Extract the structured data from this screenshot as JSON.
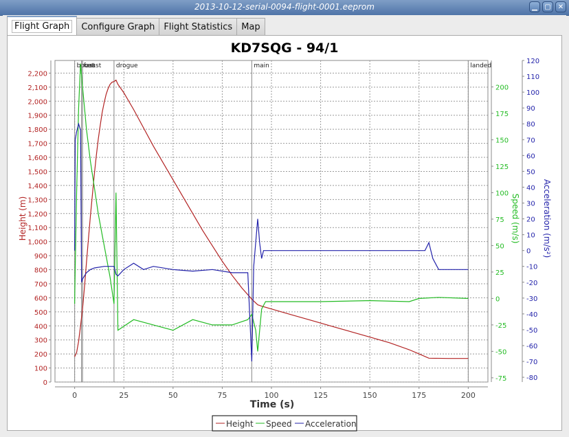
{
  "window": {
    "title": "2013-10-12-serial-0094-flight-0001.eeprom",
    "buttons": [
      "minimize",
      "maximize",
      "close"
    ]
  },
  "tabs": [
    {
      "label": "Flight Graph",
      "active": true
    },
    {
      "label": "Configure Graph",
      "active": false
    },
    {
      "label": "Flight Statistics",
      "active": false
    },
    {
      "label": "Map",
      "active": false
    }
  ],
  "chart_data": {
    "type": "line",
    "title": "KD7SQG - 94/1",
    "xlabel": "Time (s)",
    "xlim": [
      -10,
      210
    ],
    "xticks": [
      0,
      25,
      50,
      75,
      100,
      125,
      150,
      175,
      200
    ],
    "grid": true,
    "legend_position": "bottom-center",
    "axes": {
      "height": {
        "label": "Height (m)",
        "side": "left",
        "color": "#b22222",
        "ylim": [
          0,
          2290
        ],
        "ticks": [
          0,
          100,
          200,
          300,
          400,
          500,
          600,
          700,
          800,
          900,
          1000,
          1100,
          1200,
          1300,
          1400,
          1500,
          1600,
          1700,
          1800,
          1900,
          2000,
          2100,
          2200
        ],
        "tick_labels": [
          "0",
          "100",
          "200",
          "300",
          "400",
          "500",
          "600",
          "700",
          "800",
          "900",
          "1,000",
          "1,100",
          "1,200",
          "1,300",
          "1,400",
          "1,500",
          "1,600",
          "1,700",
          "1,800",
          "1,900",
          "2,000",
          "2,100",
          "2,200"
        ]
      },
      "speed": {
        "label": "Speed (m/s)",
        "side": "right",
        "color": "#22bb22",
        "ylim": [
          -79,
          225
        ],
        "ticks": [
          -75,
          -50,
          -25,
          0,
          25,
          50,
          75,
          100,
          125,
          150,
          175,
          200
        ]
      },
      "acceleration": {
        "label": "Acceleration (m/s²)",
        "side": "right",
        "color": "#2222aa",
        "ylim": [
          -83,
          120
        ],
        "ticks": [
          -80,
          -70,
          -60,
          -50,
          -40,
          -30,
          -20,
          -10,
          0,
          10,
          20,
          30,
          40,
          50,
          60,
          70,
          80,
          90,
          100,
          110,
          120
        ]
      }
    },
    "markers": [
      {
        "label": "boost",
        "t": 0
      },
      {
        "label": "fast",
        "t": 3.5
      },
      {
        "label": "coast",
        "t": 4
      },
      {
        "label": "drogue",
        "t": 20
      },
      {
        "label": "main",
        "t": 90
      },
      {
        "label": "landed",
        "t": 200
      }
    ],
    "series": [
      {
        "name": "Height",
        "axis": "height",
        "color": "#b22222",
        "points": [
          [
            0,
            180
          ],
          [
            1,
            210
          ],
          [
            2,
            290
          ],
          [
            3,
            400
          ],
          [
            4,
            520
          ],
          [
            5,
            680
          ],
          [
            6,
            850
          ],
          [
            7,
            1020
          ],
          [
            8,
            1180
          ],
          [
            9,
            1330
          ],
          [
            10,
            1480
          ],
          [
            11,
            1610
          ],
          [
            12,
            1730
          ],
          [
            13,
            1830
          ],
          [
            14,
            1920
          ],
          [
            15,
            1990
          ],
          [
            16,
            2050
          ],
          [
            17,
            2090
          ],
          [
            18,
            2120
          ],
          [
            19,
            2135
          ],
          [
            20,
            2140
          ],
          [
            21,
            2150
          ],
          [
            22,
            2120
          ],
          [
            25,
            2060
          ],
          [
            30,
            1940
          ],
          [
            35,
            1810
          ],
          [
            40,
            1680
          ],
          [
            45,
            1560
          ],
          [
            50,
            1440
          ],
          [
            55,
            1320
          ],
          [
            60,
            1200
          ],
          [
            65,
            1080
          ],
          [
            70,
            970
          ],
          [
            75,
            860
          ],
          [
            80,
            760
          ],
          [
            85,
            670
          ],
          [
            90,
            590
          ],
          [
            93,
            550
          ],
          [
            95,
            540
          ],
          [
            100,
            520
          ],
          [
            110,
            480
          ],
          [
            120,
            440
          ],
          [
            130,
            400
          ],
          [
            140,
            360
          ],
          [
            150,
            320
          ],
          [
            160,
            280
          ],
          [
            170,
            230
          ],
          [
            175,
            200
          ],
          [
            180,
            170
          ],
          [
            190,
            168
          ],
          [
            200,
            168
          ]
        ]
      },
      {
        "name": "Speed",
        "axis": "speed",
        "color": "#22bb22",
        "points": [
          [
            0,
            -5
          ],
          [
            0.3,
            30
          ],
          [
            1,
            100
          ],
          [
            2,
            180
          ],
          [
            3,
            222
          ],
          [
            4,
            200
          ],
          [
            5,
            180
          ],
          [
            6,
            160
          ],
          [
            8,
            130
          ],
          [
            10,
            105
          ],
          [
            12,
            80
          ],
          [
            14,
            60
          ],
          [
            16,
            40
          ],
          [
            18,
            20
          ],
          [
            20,
            -5
          ],
          [
            21,
            100
          ],
          [
            22,
            -30
          ],
          [
            30,
            -20
          ],
          [
            40,
            -25
          ],
          [
            50,
            -30
          ],
          [
            60,
            -20
          ],
          [
            70,
            -25
          ],
          [
            80,
            -25
          ],
          [
            88,
            -20
          ],
          [
            90,
            -15
          ],
          [
            92,
            -30
          ],
          [
            93,
            -50
          ],
          [
            95,
            -10
          ],
          [
            97,
            -3
          ],
          [
            100,
            -3
          ],
          [
            125,
            -3
          ],
          [
            150,
            -2
          ],
          [
            170,
            -3
          ],
          [
            175,
            0
          ],
          [
            185,
            1
          ],
          [
            200,
            0
          ]
        ]
      },
      {
        "name": "Acceleration",
        "axis": "acceleration",
        "color": "#2222aa",
        "points": [
          [
            0,
            0
          ],
          [
            0.3,
            70
          ],
          [
            1,
            75
          ],
          [
            2,
            80
          ],
          [
            3,
            76
          ],
          [
            3.5,
            -20
          ],
          [
            4,
            -18
          ],
          [
            6,
            -14
          ],
          [
            8,
            -12
          ],
          [
            10,
            -11
          ],
          [
            15,
            -10
          ],
          [
            20,
            -10
          ],
          [
            21,
            -15
          ],
          [
            22,
            -16
          ],
          [
            25,
            -12
          ],
          [
            30,
            -8
          ],
          [
            35,
            -12
          ],
          [
            40,
            -10
          ],
          [
            50,
            -12
          ],
          [
            60,
            -13
          ],
          [
            70,
            -12
          ],
          [
            80,
            -14
          ],
          [
            88,
            -14
          ],
          [
            90,
            -70
          ],
          [
            91,
            -10
          ],
          [
            93,
            20
          ],
          [
            94,
            5
          ],
          [
            95,
            -5
          ],
          [
            96,
            0
          ],
          [
            100,
            0
          ],
          [
            150,
            0
          ],
          [
            178,
            0
          ],
          [
            180,
            5
          ],
          [
            182,
            -5
          ],
          [
            185,
            -12
          ],
          [
            200,
            -12
          ]
        ]
      }
    ]
  },
  "legend": [
    {
      "label": "Height",
      "color": "#b22222"
    },
    {
      "label": "Speed",
      "color": "#22bb22"
    },
    {
      "label": "Acceleration",
      "color": "#2222aa"
    }
  ]
}
